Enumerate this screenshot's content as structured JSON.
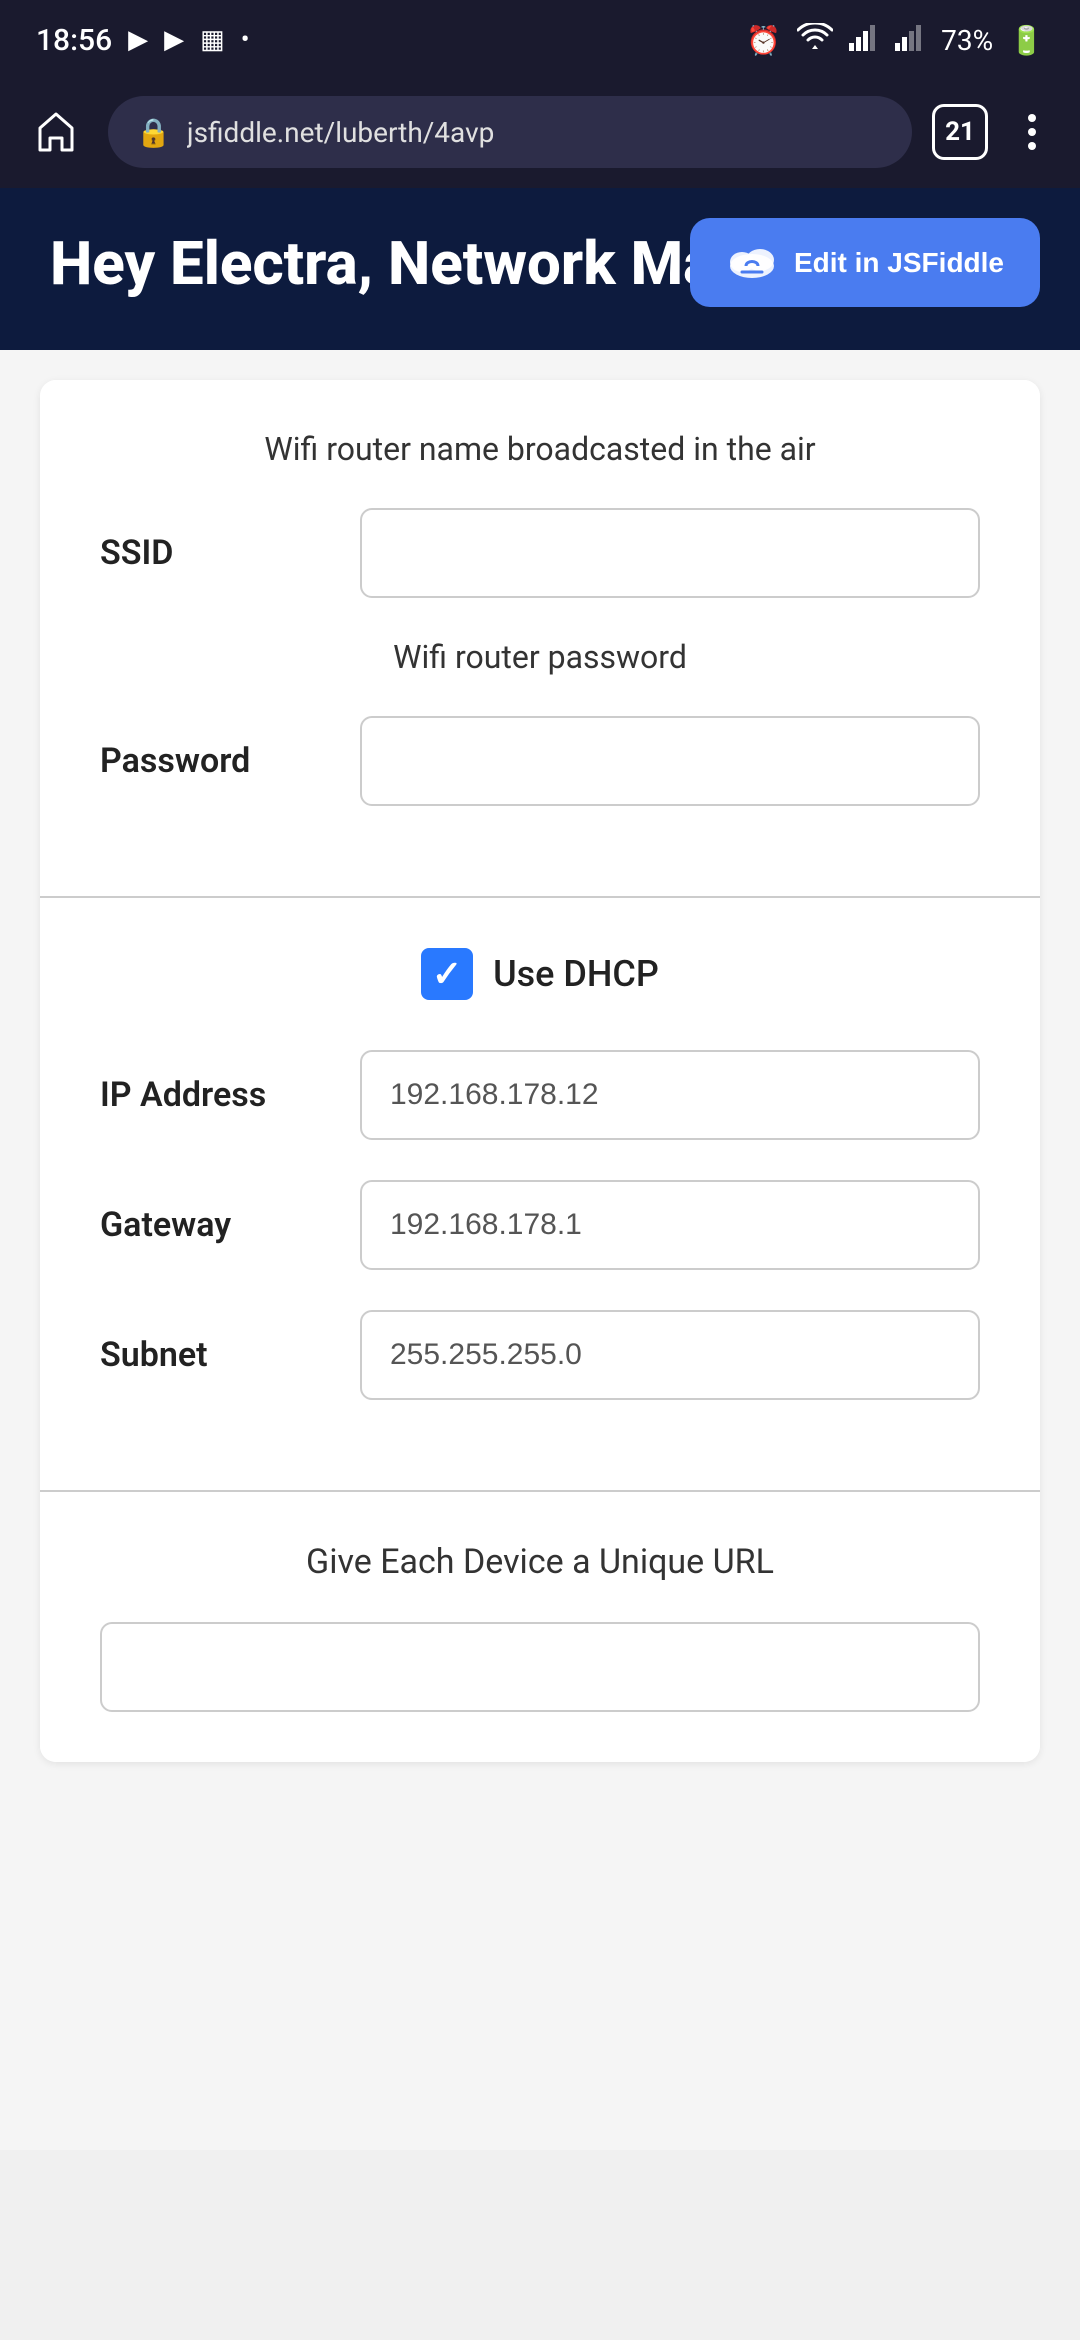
{
  "statusBar": {
    "time": "18:56",
    "icons": [
      "▶",
      "▶",
      "📅",
      "•"
    ],
    "rightIcons": [
      "🔔",
      "wifi",
      "signal1",
      "signal2",
      "battery"
    ],
    "batteryPercent": "73%"
  },
  "browser": {
    "homeIcon": "⌂",
    "url": "jsfiddle.net/luberth/4avp",
    "tabCount": "21",
    "menuDots": 3
  },
  "header": {
    "title": "Hey Electra, Network Manager",
    "editButton": "Edit in JSFiddle"
  },
  "wifiSection": {
    "description": "Wifi router name broadcasted in the air",
    "ssidLabel": "SSID",
    "ssidValue": "",
    "ssidPlaceholder": "",
    "passwordDescription": "Wifi router password",
    "passwordLabel": "Password",
    "passwordValue": "",
    "passwordPlaceholder": ""
  },
  "networkSection": {
    "dhcpLabel": "Use DHCP",
    "dhcpChecked": true,
    "ipLabel": "IP Address",
    "ipValue": "192.168.178.12",
    "gatewayLabel": "Gateway",
    "gatewayValue": "192.168.178.1",
    "subnetLabel": "Subnet",
    "subnetValue": "255.255.255.0"
  },
  "urlSection": {
    "description": "Give Each Device a Unique URL"
  }
}
